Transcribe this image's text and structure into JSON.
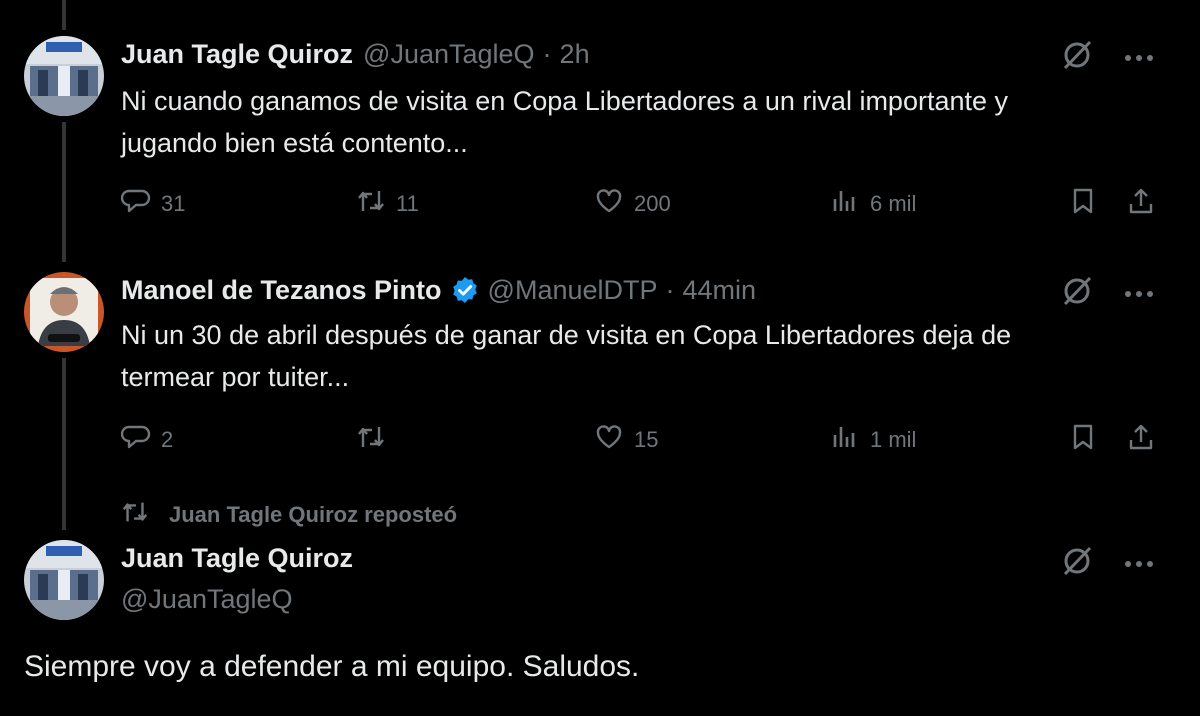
{
  "tweets": [
    {
      "name": "Juan Tagle Quiroz",
      "handle": "@JuanTagleQ",
      "time": "2h",
      "text_line1": "Ni cuando ganamos de visita en Copa Libertadores a un rival importante y",
      "text_line2": "jugando bien está contento...",
      "replies": "31",
      "reposts": "11",
      "likes": "200",
      "views": "6 mil"
    },
    {
      "name": "Manoel de Tezanos Pinto",
      "handle": "@ManuelDTP",
      "time": "44min",
      "verified": true,
      "text_line1": "Ni un 30 de abril después de ganar de visita en Copa Libertadores deja de",
      "text_line2": "termear por tuiter...",
      "replies": "2",
      "reposts": "",
      "likes": "15",
      "views": "1 mil"
    }
  ],
  "repost_banner": "Juan Tagle Quiroz reposteó",
  "main_tweet": {
    "name": "Juan Tagle Quiroz",
    "handle": "@JuanTagleQ",
    "text": "Siempre voy a defender a mi equipo. Saludos."
  },
  "colors": {
    "background": "#000000",
    "text": "#e7e9ea",
    "muted": "#71767b",
    "verified": "#1d9bf0",
    "thread_line": "#333639"
  },
  "icons": [
    "reply-icon",
    "repost-icon",
    "like-icon",
    "views-icon",
    "bookmark-icon",
    "share-icon",
    "grok-icon",
    "more-icon",
    "verified-badge-icon"
  ]
}
